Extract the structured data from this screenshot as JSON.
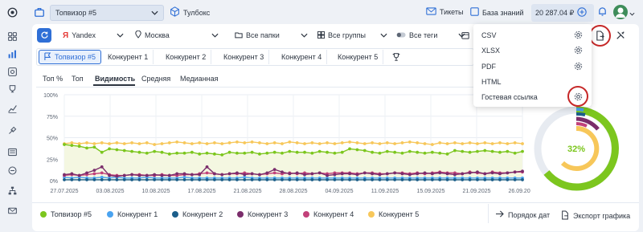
{
  "topbar": {
    "project_name": "Топвизор #5",
    "toolbox_label": "Тулбокс",
    "tickets_label": "Тикеты",
    "knowledge_label": "База знаний",
    "balance": "20 287.04 ₽"
  },
  "filters": {
    "engine": "Yandex",
    "region": "Москва",
    "folders": "Все папки",
    "groups": "Все группы",
    "tags": "Все теги"
  },
  "competitor_tabs": [
    "Топвизор #5",
    "Конкурент 1",
    "Конкурент 2",
    "Конкурент 3",
    "Конкурент 4",
    "Конкурент 5"
  ],
  "view_tabs": [
    "Топ %",
    "Топ",
    "Видимость",
    "Средняя",
    "Медианная"
  ],
  "active_view_tab": "Видимость",
  "export_menu": {
    "items": [
      "CSV",
      "XLSX",
      "PDF",
      "HTML",
      "Гостевая ссылка"
    ]
  },
  "donut": {
    "value_label": "32%",
    "value": 32
  },
  "legend": [
    "Топвизор #5",
    "Конкурент 1",
    "Конкурент 2",
    "Конкурент 3",
    "Конкурент 4",
    "Конкурент 5"
  ],
  "footer": {
    "date_order_label": "Порядок дат",
    "export_chart_label": "Экспорт графика"
  },
  "colors": {
    "accent": "#2f6fd6",
    "series": [
      "#7cc61e",
      "#4aa3f0",
      "#1b5e8a",
      "#7b2d6b",
      "#c2417a",
      "#f7c75a"
    ],
    "highlight_ring": "#c62828"
  },
  "icons": [
    "logo-icon",
    "briefcase-icon",
    "cube-icon",
    "mail-icon",
    "book-icon",
    "plus-icon",
    "bell-icon",
    "avatar-icon",
    "refresh-icon",
    "yandex-icon",
    "pin-icon",
    "folder-icon",
    "grid-icon",
    "tag-icon",
    "calendar-icon",
    "flag-icon",
    "trophy-icon",
    "export-icon",
    "tools-icon",
    "gear-icon",
    "arrow-icon"
  ],
  "chart_data": {
    "type": "line",
    "x_ticks": [
      "27.07.2025",
      "03.08.2025",
      "10.08.2025",
      "17.08.2025",
      "21.08.2025",
      "28.08.2025",
      "04.09.2025",
      "11.09.2025",
      "15.09.2025",
      "21.09.2025",
      "26.09.2025"
    ],
    "y_ticks": [
      "0%",
      "25%",
      "50%",
      "75%",
      "100%"
    ],
    "ylim": [
      0,
      100
    ],
    "n_points": 62,
    "series": [
      {
        "name": "Топвизор #5",
        "values": [
          42,
          41,
          40,
          38,
          39,
          33,
          37,
          36,
          35,
          34,
          33,
          32,
          34,
          33,
          31,
          32,
          32,
          33,
          31,
          32,
          31,
          30,
          33,
          32,
          32,
          33,
          31,
          32,
          33,
          32,
          34,
          33,
          33,
          32,
          34,
          33,
          32,
          33,
          37,
          36,
          35,
          33,
          32,
          34,
          33,
          32,
          34,
          33,
          32,
          33,
          32,
          31,
          35,
          34,
          33,
          34,
          35,
          34,
          33,
          34,
          32,
          34
        ]
      },
      {
        "name": "Конкурент 1",
        "values": [
          4,
          3,
          4,
          3,
          3,
          4,
          3,
          4,
          3,
          3,
          3,
          4,
          3,
          3,
          3,
          3,
          4,
          3,
          3,
          3,
          3,
          3,
          3,
          3,
          4,
          3,
          3,
          3,
          3,
          3,
          3,
          3,
          3,
          3,
          3,
          3,
          3,
          3,
          3,
          3,
          3,
          3,
          3,
          3,
          3,
          3,
          3,
          3,
          3,
          3,
          3,
          3,
          3,
          3,
          3,
          3,
          3,
          3,
          3,
          3,
          3,
          3
        ]
      },
      {
        "name": "Конкурент 2",
        "values": [
          1,
          1,
          1,
          1,
          1,
          1,
          1,
          1,
          1,
          1,
          1,
          1,
          1,
          1,
          1,
          1,
          1,
          1,
          1,
          1,
          1,
          1,
          1,
          1,
          1,
          1,
          1,
          1,
          1,
          1,
          1,
          1,
          1,
          1,
          1,
          1,
          1,
          1,
          1,
          1,
          1,
          1,
          1,
          1,
          1,
          1,
          1,
          1,
          1,
          1,
          1,
          1,
          1,
          1,
          1,
          1,
          1,
          1,
          1,
          1,
          1,
          1
        ]
      },
      {
        "name": "Конкурент 3",
        "values": [
          7,
          8,
          6,
          9,
          12,
          16,
          6,
          5,
          6,
          7,
          6,
          6,
          7,
          6,
          6,
          8,
          8,
          7,
          7,
          16,
          8,
          7,
          8,
          9,
          7,
          8,
          7,
          9,
          13,
          10,
          8,
          9,
          7,
          8,
          9,
          6,
          7,
          8,
          8,
          7,
          9,
          8,
          7,
          8,
          9,
          8,
          7,
          8,
          9,
          8,
          9,
          8,
          7,
          8,
          9,
          10,
          8,
          9,
          8,
          9,
          10,
          11
        ]
      },
      {
        "name": "Конкурент 4",
        "values": [
          6,
          7,
          6,
          7,
          8,
          9,
          7,
          6,
          6,
          7,
          7,
          6,
          6,
          7,
          6,
          6,
          7,
          7,
          8,
          9,
          8,
          7,
          8,
          8,
          9,
          8,
          7,
          8,
          9,
          8,
          9,
          8,
          9,
          8,
          9,
          8,
          9,
          9,
          9,
          8,
          9,
          9,
          8,
          8,
          9,
          9,
          8,
          9,
          8,
          9,
          10,
          9,
          9,
          8,
          10,
          9,
          8,
          10,
          9,
          9,
          10,
          10
        ]
      },
      {
        "name": "Конкурент 5",
        "values": [
          43,
          44,
          43,
          44,
          43,
          44,
          43,
          44,
          43,
          44,
          43,
          44,
          42,
          43,
          44,
          45,
          44,
          43,
          44,
          43,
          44,
          43,
          44,
          45,
          44,
          45,
          44,
          43,
          44,
          43,
          45,
          44,
          43,
          44,
          43,
          44,
          43,
          44,
          45,
          44,
          43,
          44,
          43,
          44,
          43,
          44,
          45,
          44,
          43,
          42,
          44,
          43,
          44,
          43,
          44,
          43,
          44,
          43,
          44,
          43,
          44,
          43
        ]
      }
    ]
  }
}
